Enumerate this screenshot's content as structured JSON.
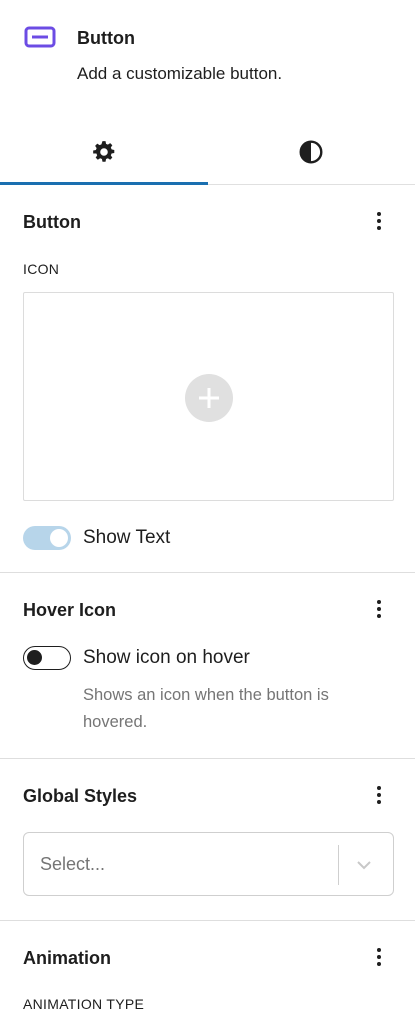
{
  "block": {
    "icon": "button-block-icon",
    "title": "Button",
    "description": "Add a customizable button."
  },
  "tabs": [
    {
      "icon": "gear-icon",
      "active": true
    },
    {
      "icon": "contrast-icon",
      "active": false
    }
  ],
  "panels": {
    "button": {
      "title": "Button",
      "icon_label": "ICON",
      "show_text_label": "Show Text",
      "show_text_on": true
    },
    "hover_icon": {
      "title": "Hover Icon",
      "toggle_label": "Show icon on hover",
      "toggle_on": false,
      "help": "Shows an icon when the button is hovered."
    },
    "global_styles": {
      "title": "Global Styles",
      "select_placeholder": "Select..."
    },
    "animation": {
      "title": "Animation",
      "type_label": "ANIMATION TYPE"
    }
  },
  "colors": {
    "accent": "#6c4ce4",
    "tab_indicator": "#1a6fb0",
    "toggle_on": "#b7d5ea"
  }
}
